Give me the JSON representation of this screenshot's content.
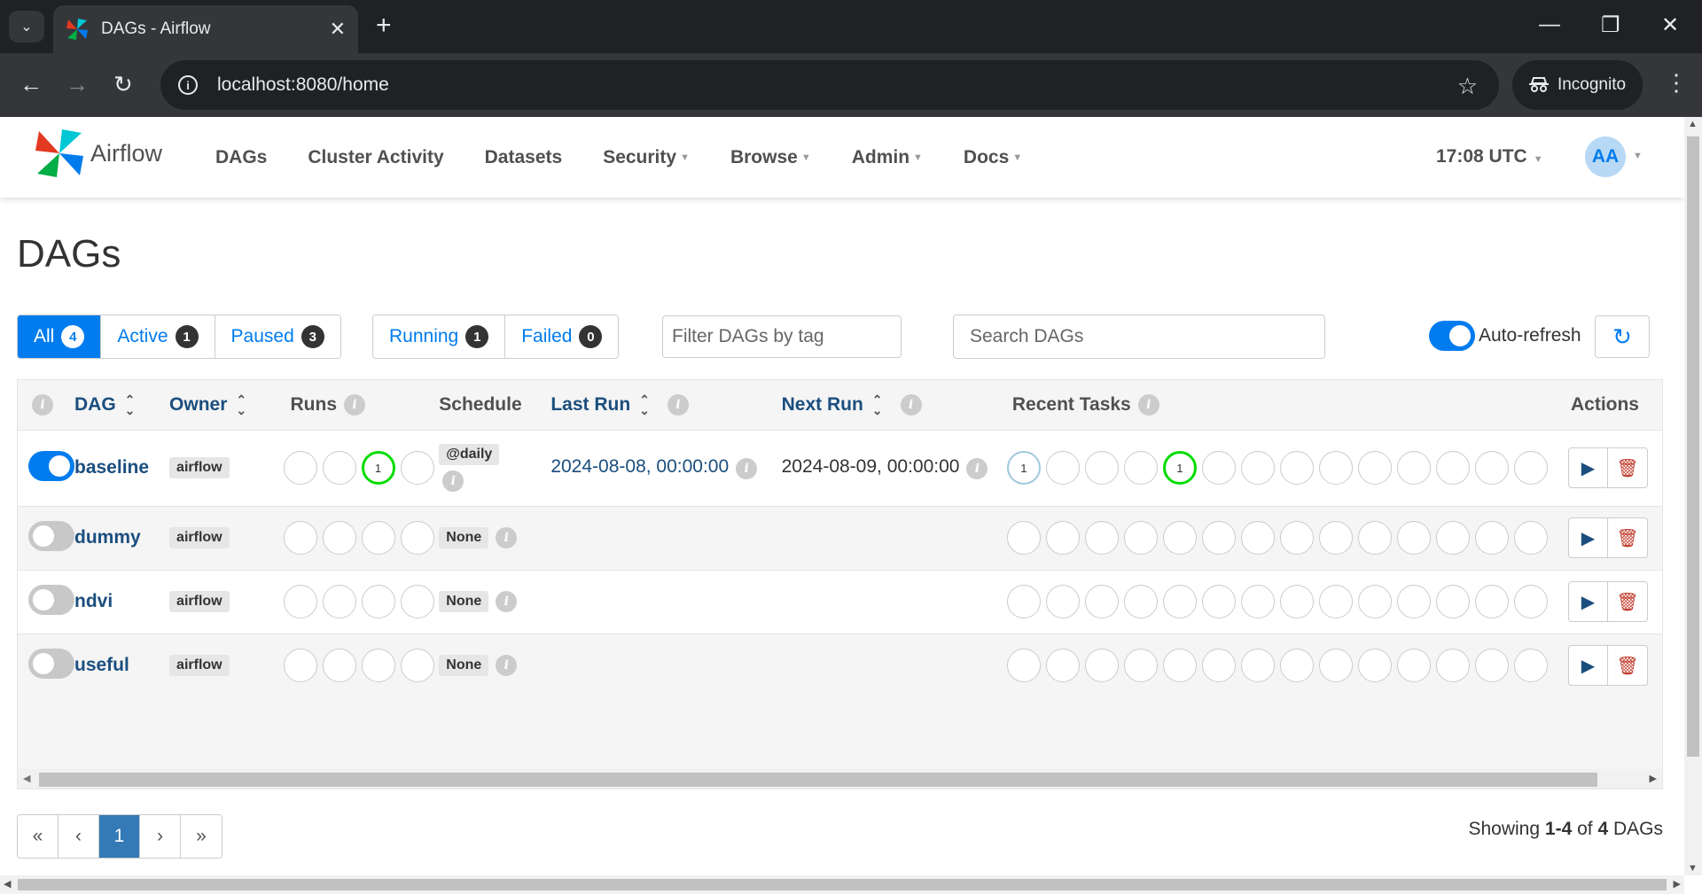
{
  "browser": {
    "tab_title": "DAGs - Airflow",
    "url": "localhost:8080/home",
    "incognito_label": "Incognito"
  },
  "navbar": {
    "brand": "Airflow",
    "links": [
      "DAGs",
      "Cluster Activity",
      "Datasets",
      "Security",
      "Browse",
      "Admin",
      "Docs"
    ],
    "clock": "17:08 UTC",
    "avatar": "AA"
  },
  "page_title": "DAGs",
  "filters": {
    "all": {
      "label": "All",
      "count": "4"
    },
    "active": {
      "label": "Active",
      "count": "1"
    },
    "paused": {
      "label": "Paused",
      "count": "3"
    },
    "running": {
      "label": "Running",
      "count": "1"
    },
    "failed": {
      "label": "Failed",
      "count": "0"
    },
    "tag_placeholder": "Filter DAGs by tag",
    "search_placeholder": "Search DAGs",
    "auto_refresh_label": "Auto-refresh"
  },
  "table": {
    "headers": {
      "dag": "DAG",
      "owner": "Owner",
      "runs": "Runs",
      "schedule": "Schedule",
      "last_run": "Last Run",
      "next_run": "Next Run",
      "recent_tasks": "Recent Tasks",
      "actions": "Actions"
    },
    "rows": [
      {
        "name": "baseline",
        "owner": "airflow",
        "schedule": "@daily",
        "last_run": "2024-08-08, 00:00:00",
        "next_run": "2024-08-09, 00:00:00",
        "run_count": "1",
        "task_queued": "1",
        "task_success": "1"
      },
      {
        "name": "dummy",
        "owner": "airflow",
        "schedule": "None"
      },
      {
        "name": "ndvi",
        "owner": "airflow",
        "schedule": "None"
      },
      {
        "name": "useful",
        "owner": "airflow",
        "schedule": "None"
      }
    ]
  },
  "pagination": {
    "first": "«",
    "prev": "‹",
    "current": "1",
    "next": "›",
    "last": "»"
  },
  "showing": {
    "prefix": "Showing",
    "range": "1-4",
    "of": "of",
    "total": "4",
    "suffix": "DAGs"
  }
}
